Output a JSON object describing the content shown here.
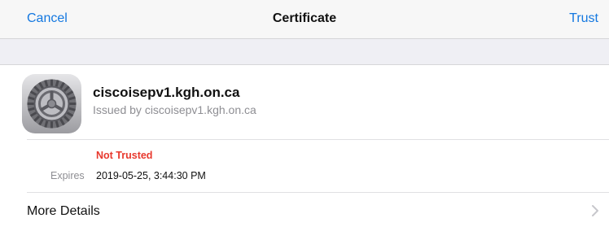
{
  "navbar": {
    "cancel_label": "Cancel",
    "title": "Certificate",
    "trust_label": "Trust"
  },
  "certificate": {
    "icon": "settings-gear-icon",
    "name": "ciscoisepv1.kgh.on.ca",
    "issuer": "Issued by ciscoisepv1.kgh.on.ca",
    "status": "Not Trusted",
    "expires_label": "Expires",
    "expires_value": "2019-05-25, 3:44:30 PM"
  },
  "details": {
    "more_label": "More Details",
    "chevron_icon": "chevron-right-icon"
  },
  "colors": {
    "accent": "#1478e0",
    "danger": "#e8382d",
    "secondary_text": "#8e8e93",
    "group_background": "#efeff4"
  }
}
